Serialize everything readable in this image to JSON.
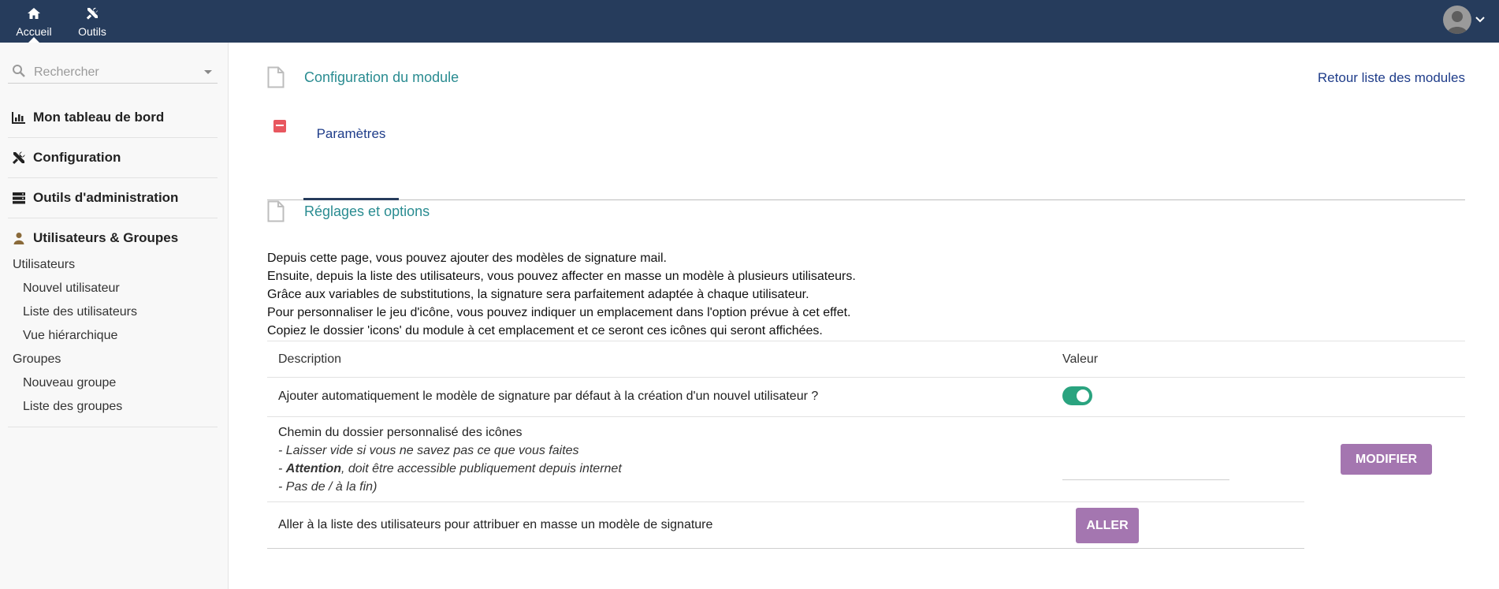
{
  "topbar": {
    "nav": [
      {
        "label": "Accueil",
        "icon": "home-icon",
        "active": true
      },
      {
        "label": "Outils",
        "icon": "tools-icon",
        "active": false
      }
    ],
    "user_icon": "user-avatar-icon"
  },
  "sidebar": {
    "search": {
      "placeholder": "Rechercher"
    },
    "menus": [
      {
        "label": "Mon tableau de bord",
        "icon": "bar-chart-icon"
      },
      {
        "label": "Configuration",
        "icon": "wrench-screwdriver-icon"
      },
      {
        "label": "Outils d'administration",
        "icon": "server-icon"
      },
      {
        "label": "Utilisateurs & Groupes",
        "icon": "user-icon",
        "groups": [
          {
            "label": "Utilisateurs",
            "items": [
              "Nouvel utilisateur",
              "Liste des utilisateurs",
              "Vue hiérarchique"
            ]
          },
          {
            "label": "Groupes",
            "items": [
              "Nouveau groupe",
              "Liste des groupes"
            ]
          }
        ]
      }
    ]
  },
  "main": {
    "header_title": "Configuration du module",
    "back_link": "Retour liste des modules",
    "tab_label": "Paramètres",
    "settings_title": "Réglages et options",
    "intro": [
      "Depuis cette page, vous pouvez ajouter des modèles de signature mail.",
      "Ensuite, depuis la liste des utilisateurs, vous pouvez affecter en masse un modèle à plusieurs utilisateurs.",
      "Grâce aux variables de substitutions, la signature sera parfaitement adaptée à chaque utilisateur.",
      "Pour personnaliser le jeu d'icône, vous pouvez indiquer un emplacement dans l'option prévue à cet effet.",
      "Copiez le dossier 'icons' du module à cet emplacement et ce seront ces icônes qui seront affichées."
    ],
    "table": {
      "col_description": "Description",
      "col_value": "Valeur",
      "row1": {
        "text": "Ajouter automatiquement le modèle de signature par défaut à la création d'un nouvel utilisateur ?",
        "toggle_on": true
      },
      "row2": {
        "text": "Chemin du dossier personnalisé des icônes",
        "note1": "- Laisser vide si vous ne savez pas ce que vous faites",
        "note2_prefix": "- ",
        "note2_bold": "Attention",
        "note2_rest": ", doit être accessible publiquement depuis internet",
        "note3": "- Pas de / à la fin)",
        "input_value": "",
        "button": "MODIFIER"
      },
      "row3": {
        "text": "Aller à la liste des utilisateurs pour attribuer en masse un modèle de signature",
        "button": "ALLER"
      }
    }
  },
  "colors": {
    "topbar": "#263c5c",
    "accent_teal": "#2a8c91",
    "link_blue": "#1f3d8a",
    "button_purple": "#a476b0",
    "toggle_green": "#2aa37f"
  }
}
